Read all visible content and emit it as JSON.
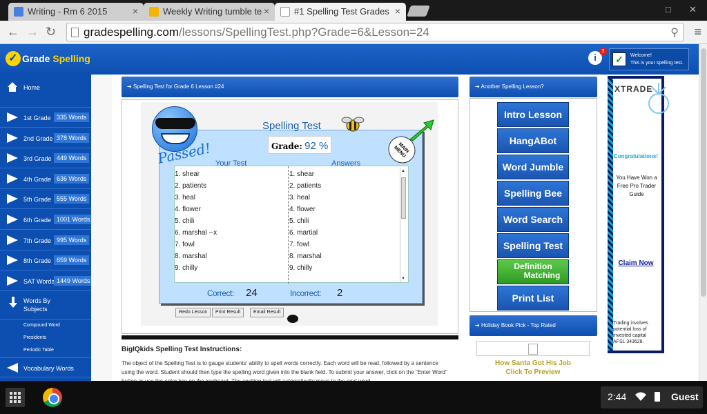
{
  "browser": {
    "tabs": [
      {
        "label": "Writing - Rm 6 2015",
        "icon_color": "#4a7fe0"
      },
      {
        "label": "Weekly Writing tumble te",
        "icon_color": "#f4b400"
      },
      {
        "label": "#1 Spelling Test Grades",
        "icon_color": "#ffffff"
      }
    ],
    "url_host": "gradespelling.com",
    "url_path": "/lessons/SpellingTest.php?Grade=6&Lesson=24",
    "nav": {
      "back": "←",
      "forward": "→",
      "reload": "↻",
      "close": "×",
      "zoom": "⚲",
      "menu": "≡",
      "minimize": "□",
      "close_window": "✕"
    }
  },
  "site": {
    "logo_text_1": "Grade ",
    "logo_text_2": "Spelling",
    "notification_count": "3",
    "info_glyph": "i",
    "welcome_line1": "Welcome!",
    "welcome_line2": "This is your spelling test."
  },
  "sidebar": {
    "home": "Home",
    "grades": [
      {
        "label": "1st Grade",
        "count": "335 Words"
      },
      {
        "label": "2nd Grade",
        "count": "378 Words"
      },
      {
        "label": "3rd Grade",
        "count": "449 Words"
      },
      {
        "label": "4th Grade",
        "count": "636 Words"
      },
      {
        "label": "5th Grade",
        "count": "555 Words"
      },
      {
        "label": "6th Grade",
        "count": "1001 Words"
      },
      {
        "label": "7th Grade",
        "count": "995 Words"
      },
      {
        "label": "8th Grade",
        "count": "659 Words"
      },
      {
        "label": "SAT Words",
        "count": "1449 Words"
      }
    ],
    "words_by_subjects": "Words By Subjects",
    "subjects": [
      "Compound Word",
      "Presidents",
      "Periodic Table"
    ],
    "vocabulary": "Vocabulary Words"
  },
  "main": {
    "header": "Spelling Test for Grade 6 Lesson #24",
    "test_title": "Spelling Test",
    "grade_label": "Grade:",
    "grade_value": "92 %",
    "passed": "Passed!",
    "main_menu": "MAIN MENU",
    "your_test_label": "Your Test",
    "answers_label": "Answers",
    "your_test": [
      "1. shear",
      "2. patients",
      "3. heal",
      "4. flower",
      "5. chili",
      "6. marshal --x",
      "7. fowl",
      "8. marshal",
      "9. chilly"
    ],
    "answers": [
      "1. shear",
      "2. patients",
      "3. heal",
      "4. flower",
      "5. chili",
      "6. martial",
      "7. fowl",
      "8. marshal",
      "9. chilly"
    ],
    "correct_label": "Correct:",
    "correct_value": "24",
    "incorrect_label": "Incorrect:",
    "incorrect_value": "2",
    "buttons": [
      "Redo Lesson",
      "Print Result",
      "Email Result"
    ],
    "instructions_title": "BigIQkids Spelling Test Instructions:",
    "instructions_text": "The object of the Spelling Test is to gauge students' ability to spell words correctly. Each word will be read, followed by a sentence using the word. Student should then type the spelling word given into the blank field. To submit your answer, click on the \"Enter Word\" button or use the enter key on the keyboard. The spelling test will automatically move to the next word."
  },
  "right": {
    "header": "Another Spelling Lesson?",
    "buttons": [
      "Intro Lesson",
      "HangABot",
      "Word Jumble",
      "Spelling Bee",
      "Word Search",
      "Spelling Test"
    ],
    "definition_1": "Definition",
    "definition_2": "Matching",
    "print_list": "Print List",
    "book_header": "Holiday Book Pick - Top Rated",
    "book_link_1": "How Santa Got His Job",
    "book_link_2": "Click To Preview"
  },
  "ad": {
    "brand": "XTRADE",
    "congrats": "Congratulations!",
    "offer": "You Have Won a Free Pro Trader Guide",
    "claim": "Claim Now",
    "risk": "Trading involves potential loss of invested capital AFSL 343628."
  },
  "shelf": {
    "time": "2:44",
    "user": "Guest"
  }
}
